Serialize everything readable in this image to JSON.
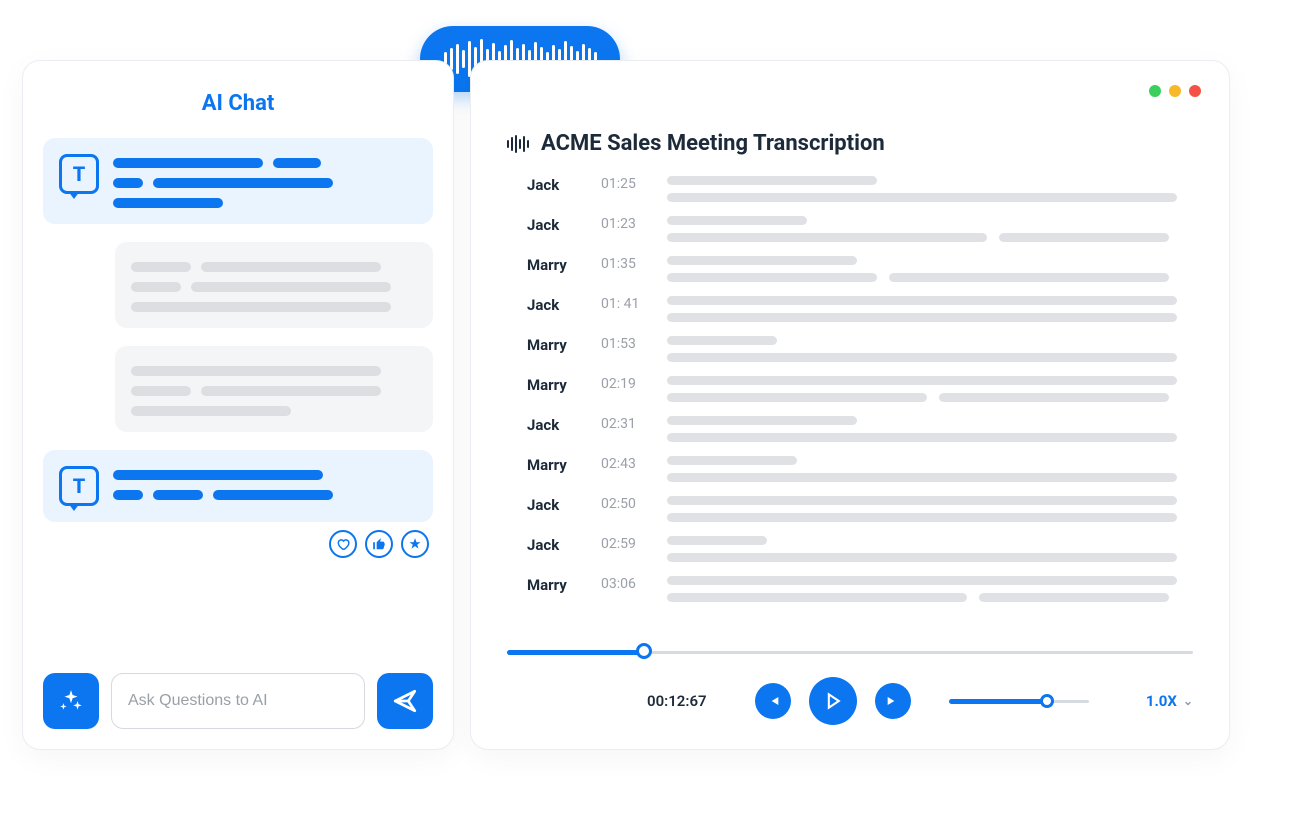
{
  "chat": {
    "title": "AI Chat",
    "input_placeholder": "Ask Questions to AI",
    "avatar_letter": "T"
  },
  "transcript": {
    "title": "ACME Sales Meeting Transcription",
    "rows": [
      {
        "speaker": "Jack",
        "time": "01:25"
      },
      {
        "speaker": "Jack",
        "time": "01:23"
      },
      {
        "speaker": "Marry",
        "time": "01:35"
      },
      {
        "speaker": "Jack",
        "time": "01: 41"
      },
      {
        "speaker": "Marry",
        "time": "01:53"
      },
      {
        "speaker": "Marry",
        "time": "02:19"
      },
      {
        "speaker": "Jack",
        "time": "02:31"
      },
      {
        "speaker": "Marry",
        "time": "02:43"
      },
      {
        "speaker": "Jack",
        "time": "02:50"
      },
      {
        "speaker": "Jack",
        "time": "02:59"
      },
      {
        "speaker": "Marry",
        "time": "03:06"
      }
    ]
  },
  "player": {
    "elapsed": "00:12:67",
    "speed": "1.0X"
  }
}
